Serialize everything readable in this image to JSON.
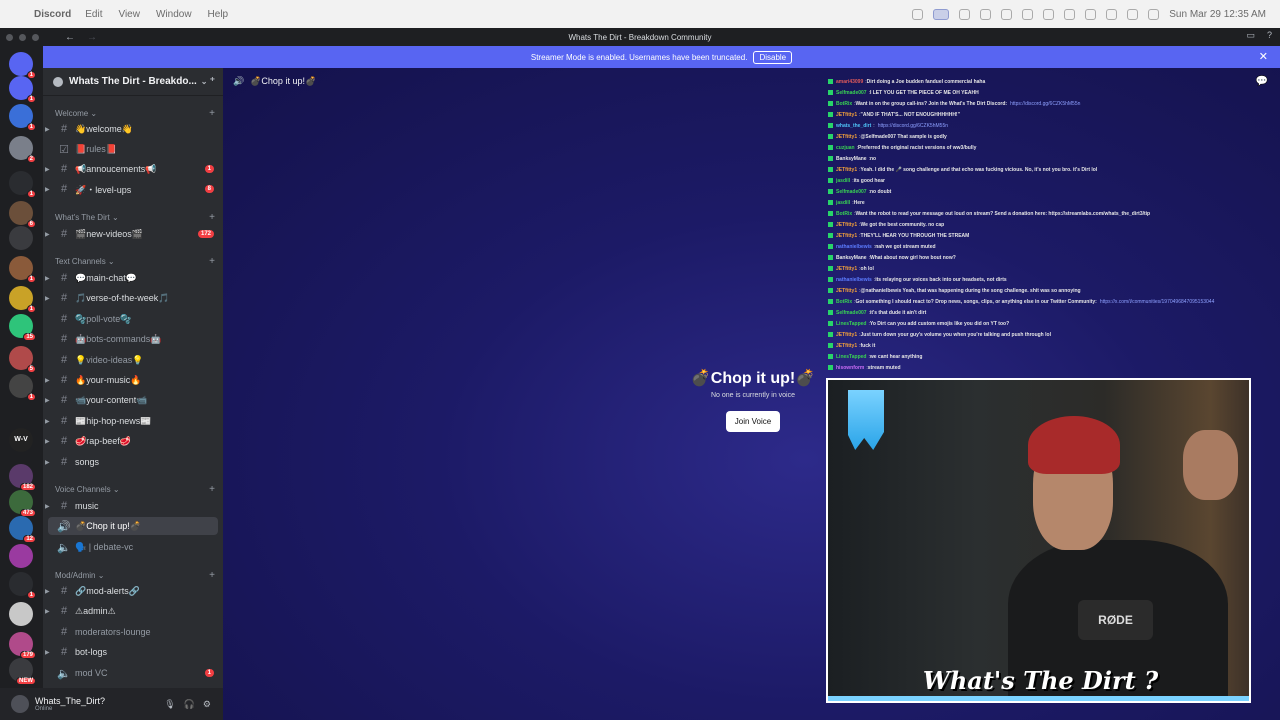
{
  "menubar": {
    "app_name": "Discord",
    "items": [
      "Edit",
      "View",
      "Window",
      "Help"
    ],
    "clock": "Sun Mar 29  12:35 AM"
  },
  "window": {
    "title": "Whats The Dirt - Breakdown Community"
  },
  "banner": {
    "text": "Streamer Mode is enabled. Usernames have been truncated.",
    "disable_label": "Disable"
  },
  "servers": [
    {
      "badge": "1"
    },
    {
      "badge": "1"
    },
    {
      "badge": "1"
    },
    {
      "badge": "2"
    },
    {
      "badge": "1"
    },
    {
      "badge": "6"
    },
    {
      "badge": ""
    },
    {
      "badge": "1"
    },
    {
      "badge": "1"
    },
    {
      "badge": "15"
    },
    {
      "badge": "5"
    },
    {
      "badge": "1"
    },
    {
      "badge": "",
      "text": "W-V"
    },
    {
      "badge": "182"
    },
    {
      "badge": "473"
    },
    {
      "badge": "12"
    },
    {
      "badge": ""
    },
    {
      "badge": "1"
    },
    {
      "badge": ""
    },
    {
      "badge": "179"
    },
    {
      "badge": "NEW"
    }
  ],
  "guild": {
    "name": "Whats The Dirt - Breakdo..."
  },
  "categories": {
    "welcome": "Welcome",
    "whats_the_dirt": "What's The Dirt",
    "text": "Text Channels",
    "voice": "Voice Channels",
    "mod": "Mod/Admin"
  },
  "channels": {
    "welcome": {
      "name": "👋welcome👋"
    },
    "rules": {
      "name": "📕rules📕"
    },
    "announcements": {
      "name": "📢annoucements📢",
      "badge": "1"
    },
    "levelups": {
      "name": "🚀・level-ups",
      "badge": "8"
    },
    "newvideos": {
      "name": "🎬new-videos🎬",
      "badge": "172"
    },
    "mainchat": {
      "name": "💬main-chat💬"
    },
    "verse": {
      "name": "🎵verse-of-the-week🎵"
    },
    "poll": {
      "name": "🫧poll-vote🫧"
    },
    "bots": {
      "name": "🤖bots-commands🤖"
    },
    "videoideas": {
      "name": "💡video-ideas💡"
    },
    "yourmusic": {
      "name": "🔥your-music🔥"
    },
    "yourcontent": {
      "name": "📹your-content📹"
    },
    "hiphop": {
      "name": "📰hip-hop-news📰"
    },
    "rapbeef": {
      "name": "🥩rap-beef🥩"
    },
    "songs": {
      "name": "songs"
    },
    "music": {
      "name": "music"
    },
    "chop": {
      "name": "💣Chop it up!💣"
    },
    "debate": {
      "name": "🗣️ | debate-vc"
    },
    "modalerts": {
      "name": "🔗mod-alerts🔗"
    },
    "admin": {
      "name": "⚠admin⚠"
    },
    "modlounge": {
      "name": "moderators-lounge"
    },
    "botlogs": {
      "name": "bot-logs"
    },
    "modvc": {
      "name": "mod VC",
      "badge": "1"
    }
  },
  "user": {
    "name": "Whats_The_Dirt?",
    "status": "Online"
  },
  "voice": {
    "header": "💣Chop it up!💣",
    "title": "💣Chop it up!💣",
    "subtitle": "No one is currently in voice",
    "join_label": "Join Voice"
  },
  "chat": [
    {
      "u": "amari43099",
      "c": "#e05a5a",
      "m": "Dirt doing a Joe budden fanduel commercial haha"
    },
    {
      "u": "Selfmade007",
      "c": "#39d353",
      "m": "I LET YOU GET THE PIECE OF ME OH YEAHH"
    },
    {
      "u": "BotRix",
      "c": "#39d353",
      "m": "Want in on the group call-ins? Join the What's The Dirt Discord:",
      "l": "https://discord.gg/6CZK5hM55n"
    },
    {
      "u": "JETfitty1",
      "c": "#f2a03b",
      "m": "\"AND IF THAT'S... NOT ENOUGHHHHHH!\""
    },
    {
      "u": "whats_the_dirt",
      "c": "#4fc3f7",
      "m": "",
      "l": "https://discord.gg/6CZK5hM55n"
    },
    {
      "u": "JETfitty1",
      "c": "#f2a03b",
      "m": "@Selfmade007 That sample is godly"
    },
    {
      "u": "cuzjuan",
      "c": "#39d353",
      "m": "Preferred the original racist versions of ww3/bully"
    },
    {
      "u": "BanksyMane",
      "c": "#e6e6e6",
      "m": "no"
    },
    {
      "u": "JETfitty1",
      "c": "#f2a03b",
      "m": "Yeah. I did the 🎤 song challenge and that echo was fucking vicious. No, it's not you bro. it's Dirt lol"
    },
    {
      "u": "jasdill",
      "c": "#39d353",
      "m": "its good hear"
    },
    {
      "u": "Selfmade007",
      "c": "#39d353",
      "m": "no doubt"
    },
    {
      "u": "jasdill",
      "c": "#39d353",
      "m": "Here"
    },
    {
      "u": "BotRix",
      "c": "#39d353",
      "m": "Want the robot to read your message out loud on stream? Send a donation here: https://streamlabs.com/whats_the_dirt3/tip"
    },
    {
      "u": "JETfitty1",
      "c": "#f2a03b",
      "m": "We got the best community. no cap"
    },
    {
      "u": "JETfitty1",
      "c": "#f2a03b",
      "m": "THEY'LL HEAR YOU THROUGH THE STREAM"
    },
    {
      "u": "nathanielbewis",
      "c": "#5c7cff",
      "m": "nah we got stream muted"
    },
    {
      "u": "BanksyMane",
      "c": "#e6e6e6",
      "m": "What about now girl how bout now?"
    },
    {
      "u": "JETfitty1",
      "c": "#f2a03b",
      "m": "oh lol"
    },
    {
      "u": "nathanielbewis",
      "c": "#5c7cff",
      "m": "its relaying our voices back into our headsets, not dirts"
    },
    {
      "u": "JETfitty1",
      "c": "#f2a03b",
      "m": "@nathanielbewis Yeah, that was happening during the song challenge. shit was so annoying"
    },
    {
      "u": "BotRix",
      "c": "#39d353",
      "m": "Got something I should react to? Drop news, songs, clips, or anything else in our Twitter Community:",
      "l": "https://x.com/i/communities/1970496847095153044"
    },
    {
      "u": "Selfmade007",
      "c": "#39d353",
      "m": "it's that dude it ain't dirt"
    },
    {
      "u": "LinesTapped",
      "c": "#39d353",
      "m": "Yo Dirt can you add custom emojis like you did on YT too?"
    },
    {
      "u": "JETfitty1",
      "c": "#f2a03b",
      "m": "Just turn down your guy's volume you when you're talking and push through lol"
    },
    {
      "u": "JETfitty1",
      "c": "#f2a03b",
      "m": "fuck it"
    },
    {
      "u": "LinesTapped",
      "c": "#39d353",
      "m": "we cant hear anything"
    },
    {
      "u": "hisownform",
      "c": "#c86cf5",
      "m": "stream muted"
    }
  ],
  "stream": {
    "caption": "What's The Dirt ?",
    "mic_brand": "RØDE"
  }
}
